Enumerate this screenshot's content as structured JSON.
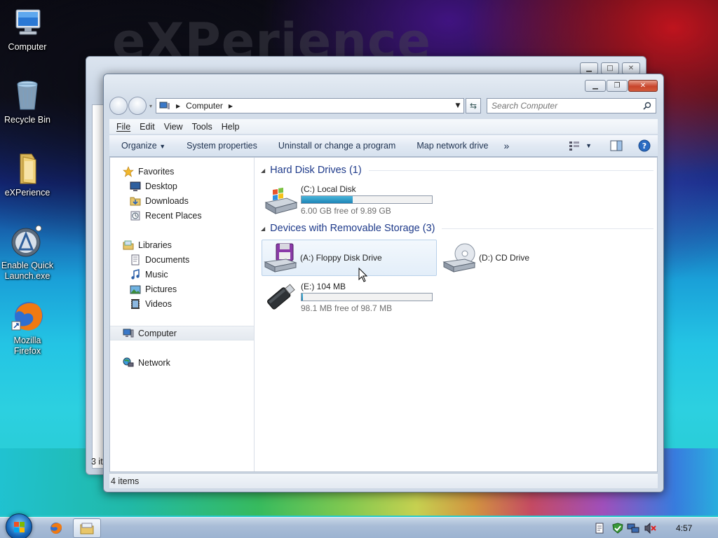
{
  "desktop": {
    "watermark": "eXPerience",
    "icons": [
      {
        "label": "Computer",
        "icon": "computer-icon"
      },
      {
        "label": "Recycle Bin",
        "icon": "recycle-bin-icon"
      },
      {
        "label": "eXPerience",
        "icon": "folder-icon"
      },
      {
        "label": "Enable Quick Launch.exe",
        "icon": "quick-launch-icon"
      },
      {
        "label": "Mozilla Firefox",
        "icon": "firefox-icon"
      }
    ]
  },
  "back_window": {
    "status": "3 it"
  },
  "window": {
    "address": "Computer",
    "search_placeholder": "Search Computer",
    "menu": [
      "File",
      "Edit",
      "View",
      "Tools",
      "Help"
    ],
    "commands": [
      "Organize",
      "System properties",
      "Uninstall or change a program",
      "Map network drive"
    ],
    "more_symbol": "»",
    "nav": {
      "favorites": "Favorites",
      "favorites_items": [
        "Desktop",
        "Downloads",
        "Recent Places"
      ],
      "libraries": "Libraries",
      "libraries_items": [
        "Documents",
        "Music",
        "Pictures",
        "Videos"
      ],
      "computer": "Computer",
      "network": "Network"
    },
    "groups": {
      "hard_disk": "Hard Disk Drives (1)",
      "removable": "Devices with Removable Storage (3)"
    },
    "drives": {
      "c": {
        "name": "(C:) Local Disk",
        "free": "6.00 GB free of 9.89 GB",
        "used_fraction": 0.393
      },
      "a": {
        "name": "(A:) Floppy Disk Drive"
      },
      "d": {
        "name": "(D:) CD Drive"
      },
      "e": {
        "name": "(E:) 104 MB",
        "free": "98.1 MB free of 98.7 MB",
        "used_fraction": 0.006
      }
    },
    "status": "4 items"
  },
  "taskbar": {
    "clock": "4:57"
  }
}
